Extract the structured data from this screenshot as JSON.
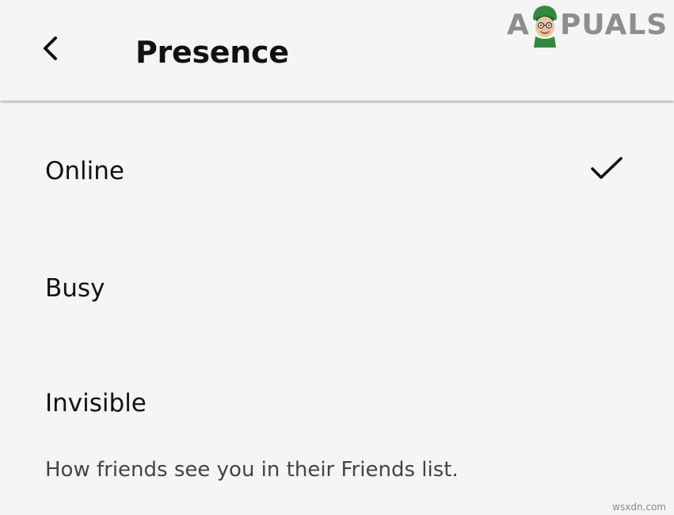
{
  "header": {
    "title": "Presence",
    "back_icon": "chevron-left-icon"
  },
  "options": [
    {
      "label": "Online",
      "selected": true
    },
    {
      "label": "Busy",
      "selected": false
    },
    {
      "label": "Invisible",
      "selected": false
    }
  ],
  "selected_icon": "checkmark-icon",
  "description": "How friends see you in their Friends list.",
  "watermark": {
    "prefix": "A",
    "suffix": "PUALS",
    "color": "#8e8e8e"
  },
  "source_label": "wsxdn.com",
  "colors": {
    "background": "#f5f5f5",
    "text": "#121212",
    "secondary_text": "#444444"
  }
}
